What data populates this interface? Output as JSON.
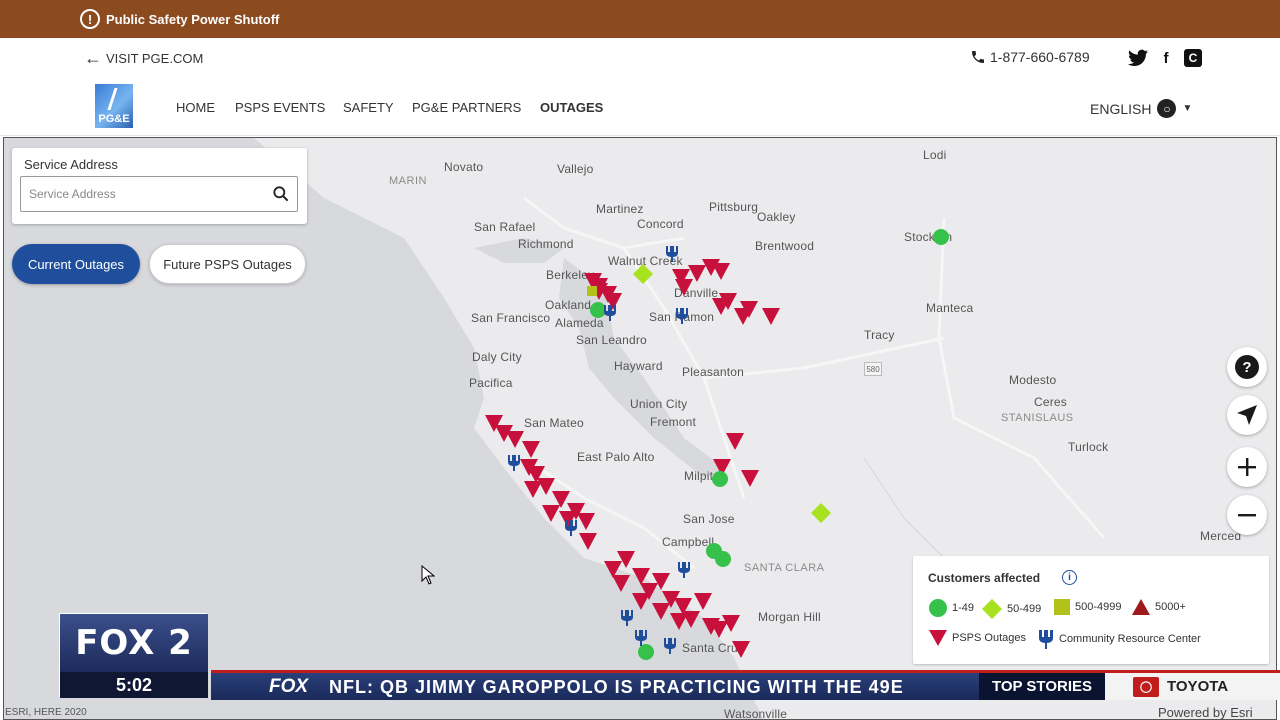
{
  "banner": {
    "text": "Public Safety Power Shutoff",
    "icon": "alert-circle-icon"
  },
  "utility": {
    "visit_label": "VISIT PGE.COM",
    "phone": "1-877-660-6789",
    "socials": [
      "twitter-icon",
      "facebook-icon",
      "c-icon"
    ]
  },
  "nav": {
    "logo_text": "PG&E",
    "items": [
      "HOME",
      "PSPS EVENTS",
      "SAFETY",
      "PG&E PARTNERS",
      "OUTAGES"
    ],
    "active": "OUTAGES",
    "language": "ENGLISH"
  },
  "search": {
    "label": "Service Address",
    "placeholder": "Service Address"
  },
  "toggles": {
    "current": "Current Outages",
    "future": "Future PSPS Outages"
  },
  "map": {
    "places": [
      "Novato",
      "Vallejo",
      "Lodi",
      "MARIN",
      "Martinez",
      "Pittsburg",
      "Concord",
      "Oakley",
      "San Rafael",
      "Richmond",
      "Brentwood",
      "Stockton",
      "Walnut Creek",
      "Berkeley",
      "Danville",
      "Oakland",
      "Manteca",
      "San Francisco",
      "Alameda",
      "San Ramon",
      "San Leandro",
      "Tracy",
      "Daly City",
      "Hayward",
      "Pleasanton",
      "Pacifica",
      "Modesto",
      "Ceres",
      "STANISLAUS",
      "Union City",
      "Fremont",
      "San Mateo",
      "Turlock",
      "East Palo Alto",
      "Milpitas",
      "San Jose",
      "Campbell",
      "SANTA CLARA",
      "Merced",
      "Morgan Hill",
      "Santa Cruz",
      "Watsonville"
    ],
    "highway": "580"
  },
  "legend": {
    "title": "Customers affected",
    "items": [
      "1-49",
      "50-499",
      "500-4999",
      "5000+"
    ],
    "psps": "PSPS Outages",
    "crc": "Community Resource Center",
    "colors": {
      "green": "#35c14a",
      "lime": "#a8e21e",
      "olive": "#b3c21a",
      "darkred": "#9e1a1a",
      "psps": "#c8103c",
      "crc": "#1f4e9c"
    }
  },
  "broadcast": {
    "station": "FOX 2",
    "time": "5:02",
    "network": "FOX",
    "ticker": "NFL: QB JIMMY GAROPPOLO IS PRACTICING WITH THE 49E",
    "top_stories": "TOP STORIES",
    "sponsor": "TOYOTA"
  },
  "attribution": {
    "left": "ESRI, HERE 2020",
    "right": "Powered by Esri"
  }
}
